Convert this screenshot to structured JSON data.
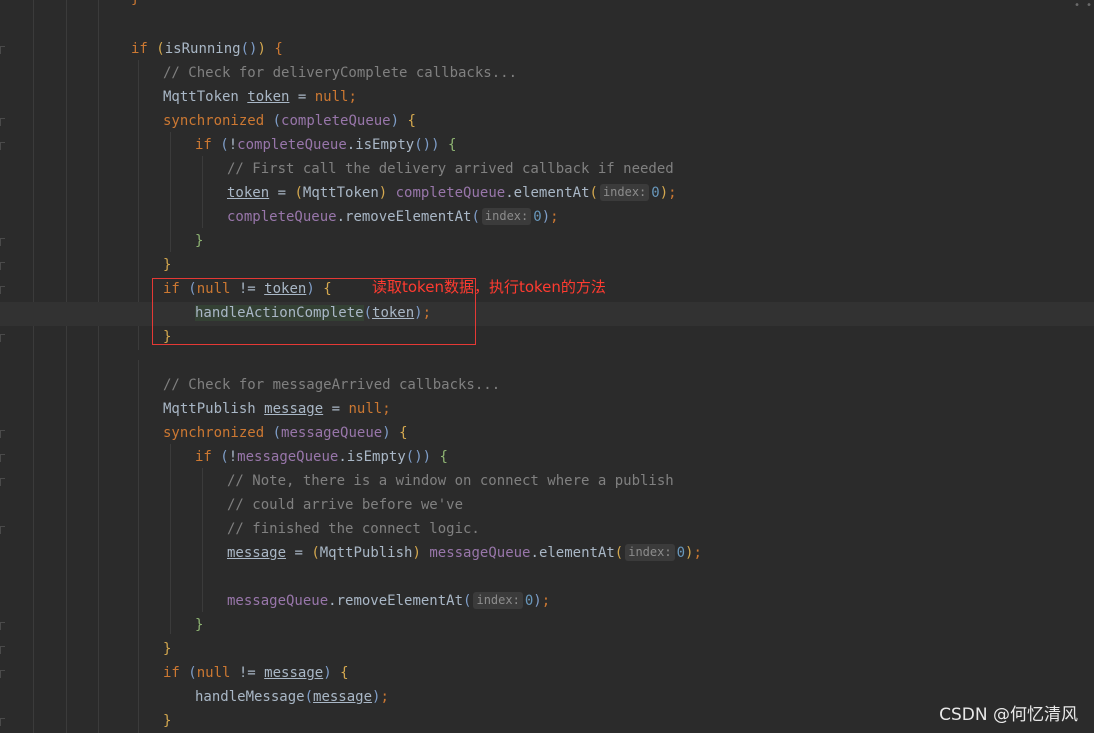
{
  "lines": {
    "l0": "}",
    "l1_if": "if",
    "l1_name": "isRunning",
    "l2": "// Check for deliveryComplete callbacks...",
    "l3_type": "MqttToken",
    "l3_var": "token",
    "l3_null": "null",
    "l4_sync": "synchronized",
    "l4_arg": "completeQueue",
    "l5_if": "if",
    "l5_obj": "completeQueue",
    "l5_call": "isEmpty",
    "l6": "// First call the delivery arrived callback if needed",
    "l7_var": "token",
    "l7_type": "MqttToken",
    "l7_obj": "completeQueue",
    "l7_call": "elementAt",
    "l7_hint": "index:",
    "l7_num": "0",
    "l8_obj": "completeQueue",
    "l8_call": "removeElementAt",
    "l8_hint": "index:",
    "l8_num": "0",
    "l11_if": "if",
    "l11_null": "null",
    "l11_var": "token",
    "l12_call": "handleActionComplete",
    "l12_var": "token",
    "l15": "// Check for messageArrived callbacks...",
    "l16_type": "MqttPublish",
    "l16_var": "message",
    "l16_null": "null",
    "l17_sync": "synchronized",
    "l17_arg": "messageQueue",
    "l18_if": "if",
    "l18_obj": "messageQueue",
    "l18_call": "isEmpty",
    "l19": "// Note, there is a window on connect where a publish",
    "l20": "// could arrive before we've",
    "l21": "// finished the connect logic.",
    "l22_var": "message",
    "l22_type": "MqttPublish",
    "l22_obj": "messageQueue",
    "l22_call": "elementAt",
    "l22_hint": "index:",
    "l22_num": "0",
    "l24_obj": "messageQueue",
    "l24_call": "removeElementAt",
    "l24_hint": "index:",
    "l24_num": "0",
    "l27_if": "if",
    "l27_null": "null",
    "l27_var": "message",
    "l28_call": "handleMessage",
    "l28_var": "message"
  },
  "annotation": "读取token数据，执行token的方法",
  "watermark": "CSDN @何忆清风",
  "colors": {
    "background": "#2b2b2b",
    "keyword": "#cc7832",
    "comment": "#808080",
    "field": "#9876aa",
    "number": "#6897bb",
    "annotation": "#ff3b30",
    "box": "#e53935"
  }
}
